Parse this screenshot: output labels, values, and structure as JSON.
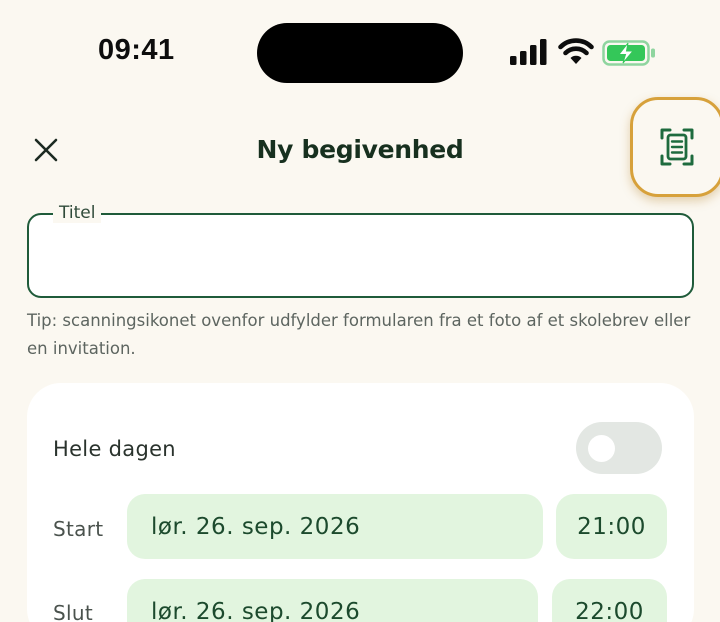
{
  "status_bar": {
    "time": "09:41"
  },
  "header": {
    "title": "Ny begivenhed",
    "close_icon": "close-icon",
    "scan_icon": "document-scan-icon"
  },
  "form": {
    "title_field": {
      "label": "Titel",
      "value": "",
      "placeholder": ""
    },
    "tip": "Tip: scanningsikonet ovenfor udfylder formularen fra et foto af et skolebrev eller en invitation."
  },
  "card": {
    "all_day": {
      "label": "Hele dagen",
      "enabled": false
    },
    "start": {
      "label": "Start",
      "date": "lør. 26. sep. 2026",
      "time": "21:00"
    },
    "end": {
      "label": "Slut",
      "date": "lør. 26. sep. 2026",
      "time": "22:00"
    }
  },
  "colors": {
    "background": "#fbf8f1",
    "accent_green": "#1f5b3a",
    "chip_green": "#e2f5df",
    "highlight_gold": "#d7a13b",
    "battery_green": "#34c759"
  }
}
